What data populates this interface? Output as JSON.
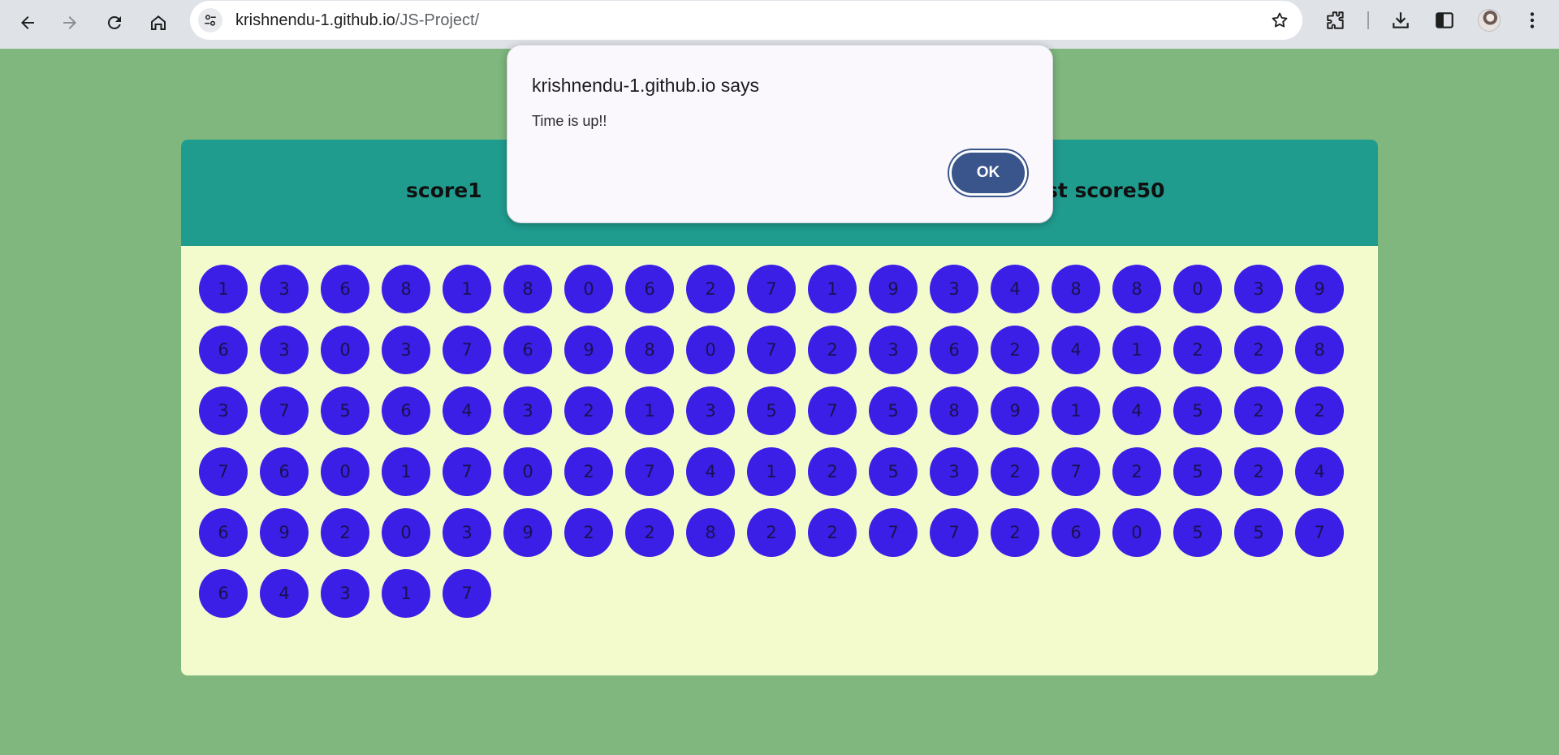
{
  "browser": {
    "url_host": "krishnendu-1.github.io",
    "url_path": "/JS-Project/",
    "icons": [
      "back-icon",
      "forward-icon",
      "reload-icon",
      "home-icon",
      "site-info-icon",
      "bookmark-star-icon",
      "extensions-icon",
      "downloads-icon",
      "side-panel-icon",
      "profile-avatar",
      "menu-kebab-icon"
    ]
  },
  "game": {
    "score_label": "score1",
    "best_score_label": "st score50",
    "bubbles": [
      "1",
      "3",
      "6",
      "8",
      "1",
      "8",
      "0",
      "6",
      "2",
      "7",
      "1",
      "9",
      "3",
      "4",
      "8",
      "8",
      "0",
      "3",
      "9",
      "6",
      "3",
      "0",
      "3",
      "7",
      "6",
      "9",
      "8",
      "0",
      "7",
      "2",
      "3",
      "6",
      "2",
      "4",
      "1",
      "2",
      "2",
      "8",
      "3",
      "7",
      "5",
      "6",
      "4",
      "3",
      "2",
      "1",
      "3",
      "5",
      "7",
      "5",
      "8",
      "9",
      "1",
      "4",
      "5",
      "2",
      "2",
      "7",
      "6",
      "0",
      "1",
      "7",
      "0",
      "2",
      "7",
      "4",
      "1",
      "2",
      "5",
      "3",
      "2",
      "7",
      "2",
      "5",
      "2",
      "4",
      "6",
      "9",
      "2",
      "0",
      "3",
      "9",
      "2",
      "2",
      "8",
      "2",
      "2",
      "7",
      "7",
      "2",
      "6",
      "0",
      "5",
      "5",
      "7",
      "6",
      "4",
      "3",
      "1",
      "7"
    ]
  },
  "dialog": {
    "title": "krishnendu-1.github.io says",
    "message": "Time is up!!",
    "ok_label": "OK"
  },
  "colors": {
    "page_background": "#7fb77e",
    "header_background": "#209c8f",
    "panel_background": "#f3fbcd",
    "bubble": "#3c1fe6",
    "ok_button": "#39558c"
  }
}
